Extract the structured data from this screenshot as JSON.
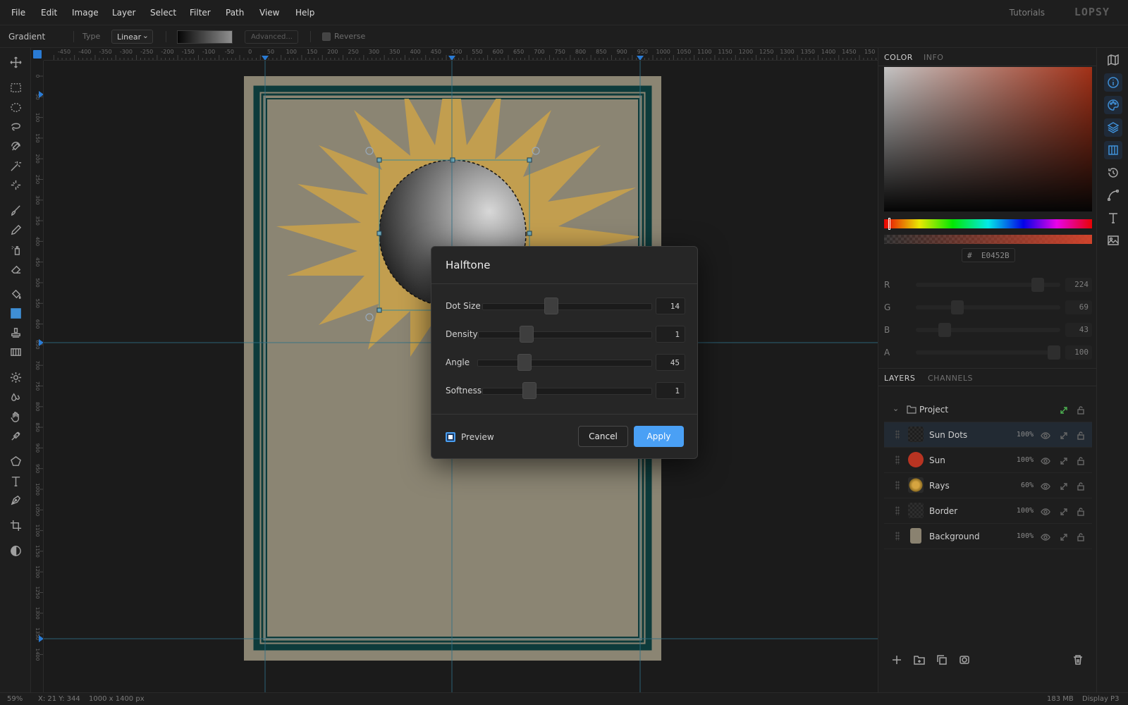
{
  "menu": [
    "File",
    "Edit",
    "Image",
    "Layer",
    "Select",
    "Filter",
    "Path",
    "View",
    "Help"
  ],
  "header": {
    "tutorials": "Tutorials",
    "logo": "LOPSY"
  },
  "options": {
    "tool_name": "Gradient",
    "type_label": "Type",
    "type_value": "Linear",
    "advanced_label": "Advanced...",
    "reverse_label": "Reverse"
  },
  "rulers": {
    "top": [
      "-450",
      "-400",
      "-350",
      "-300",
      "-250",
      "-200",
      "-150",
      "-100",
      "-50",
      "0",
      "50",
      "100",
      "150",
      "200",
      "250",
      "300",
      "350",
      "400",
      "450",
      "500",
      "550",
      "600",
      "650",
      "700",
      "750",
      "800",
      "850",
      "900",
      "950",
      "1000",
      "1050",
      "1100",
      "1150",
      "1200",
      "1250",
      "1300",
      "1350",
      "1400",
      "1450",
      "150"
    ],
    "left": [
      "0",
      "50",
      "100",
      "150",
      "200",
      "250",
      "300",
      "350",
      "400",
      "450",
      "500",
      "550",
      "600",
      "650",
      "700",
      "750",
      "800",
      "850",
      "900",
      "950",
      "1000",
      "1050",
      "1100",
      "1150",
      "1200",
      "1250",
      "1300",
      "1350",
      "1400"
    ]
  },
  "color_panel": {
    "tabs": [
      "COLOR",
      "INFO"
    ],
    "hex_prefix": "#",
    "hex": "E0452B",
    "channels": [
      {
        "label": "R",
        "value": "224",
        "level": 0.878
      },
      {
        "label": "G",
        "value": "69",
        "level": 0.27
      },
      {
        "label": "B",
        "value": "43",
        "level": 0.169
      },
      {
        "label": "A",
        "value": "100",
        "level": 1.0
      }
    ],
    "hue_level": 0.02
  },
  "layers_panel": {
    "tabs": [
      "LAYERS",
      "CHANNELS"
    ],
    "group": "Project",
    "layers": [
      {
        "name": "Sun Dots",
        "opacity": "100%",
        "thumb": "dots"
      },
      {
        "name": "Sun",
        "opacity": "100%",
        "thumb": "#b83422"
      },
      {
        "name": "Rays",
        "opacity": "60%",
        "thumb": "rays"
      },
      {
        "name": "Border",
        "opacity": "100%",
        "thumb": "checker"
      },
      {
        "name": "Background",
        "opacity": "100%",
        "thumb": "#8a8270"
      }
    ]
  },
  "dialog": {
    "title": "Halftone",
    "params": [
      {
        "label": "Dot Size",
        "value": "14",
        "level": 0.4
      },
      {
        "label": "Density",
        "value": "1",
        "level": 0.26
      },
      {
        "label": "Angle",
        "value": "45",
        "level": 0.25
      },
      {
        "label": "Softness",
        "value": "1",
        "level": 0.26
      }
    ],
    "preview_label": "Preview",
    "cancel_label": "Cancel",
    "apply_label": "Apply"
  },
  "status": {
    "zoom": "59%",
    "coords": "X: 21  Y: 344",
    "dimensions": "1000 x 1400 px",
    "memory": "183 MB",
    "display": "Display P3"
  },
  "colors": {
    "accent": "#4aa0f5",
    "border_teal": "#0f3a3a",
    "paper": "#8a8471",
    "rays": "#c9a24a"
  }
}
